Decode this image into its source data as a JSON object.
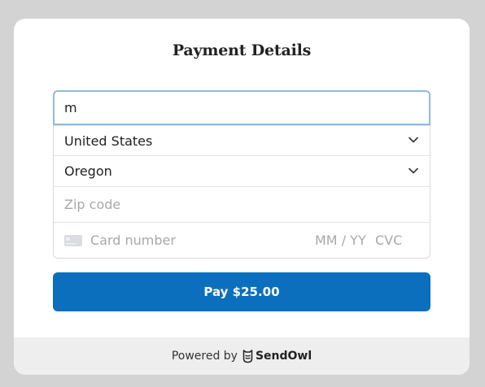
{
  "form": {
    "title": "Payment Details",
    "name_value": "m",
    "country": "United States",
    "state": "Oregon",
    "zip_placeholder": "Zip code",
    "card_number_placeholder": "Card number",
    "expiry_placeholder": "MM / YY",
    "cvc_placeholder": "CVC"
  },
  "pay_button": {
    "label": "Pay $25.00"
  },
  "footer": {
    "powered_by": "Powered by",
    "brand": "SendOwl"
  },
  "colors": {
    "accent": "#0b6fbd",
    "focus_border": "#8fbcdc",
    "background": "#d3d3d3",
    "footer_bg": "#eeeeee"
  },
  "icons": {
    "country_select": "chevron-down-icon",
    "state_select": "chevron-down-icon",
    "card": "credit-card-icon",
    "brand_logo": "owl-logo-icon"
  }
}
